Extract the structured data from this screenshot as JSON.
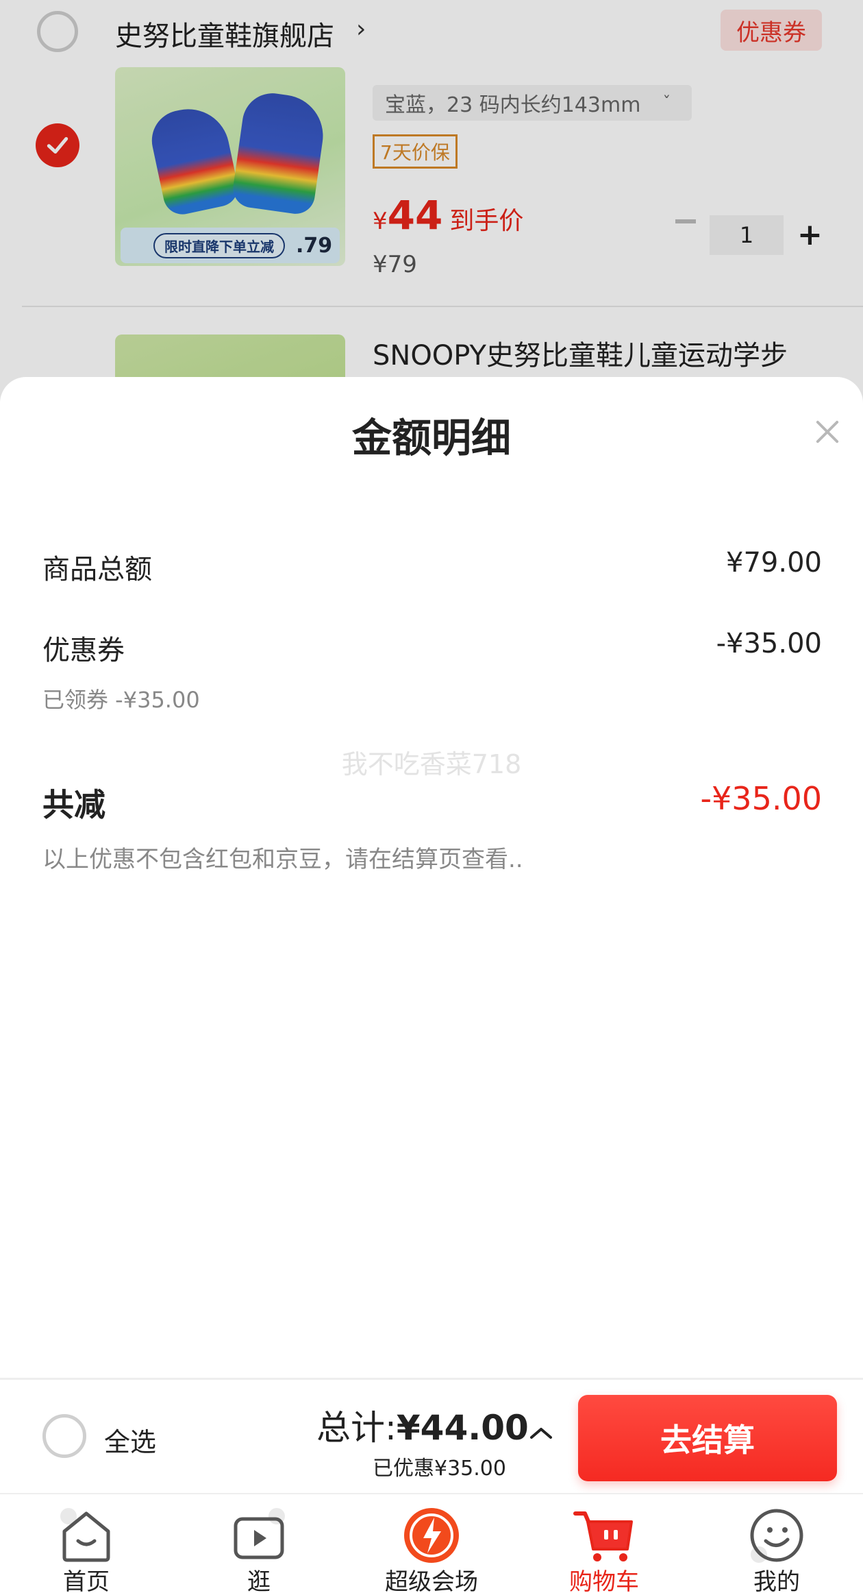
{
  "store": {
    "name": "史努比童鞋旗舰店",
    "chevron": "›",
    "coupon_tag": "优惠券"
  },
  "item": {
    "image_banner_text": "限时直降下单立减",
    "image_banner_price": ".79",
    "variant": "宝蓝，23 码内长约143mm",
    "variant_chevron": "ˇ",
    "guarantee": "7天价保",
    "price_currency": "¥",
    "price_value": "44",
    "price_label": "到手价",
    "original_price": "¥79",
    "quantity": "1",
    "plus": "+"
  },
  "item2": {
    "title": "SNOOPY史努比童鞋儿童运动学步"
  },
  "sheet": {
    "title": "金额明细",
    "rows": [
      {
        "label": "商品总额",
        "value": "¥79.00"
      },
      {
        "label": "优惠券",
        "value": "-¥35.00",
        "sub": "已领券 -¥35.00"
      }
    ],
    "watermark": "我不吃香菜718",
    "total_label": "共减",
    "total_value": "-¥35.00",
    "note": "以上优惠不包含红包和京豆，请在结算页查看.."
  },
  "checkout": {
    "select_all": "全选",
    "total_prefix": "总计:",
    "total_amount": "¥44.00",
    "saved": "已优惠¥35.00",
    "button": "去结算"
  },
  "nav": {
    "items": [
      {
        "label": "首页",
        "icon": "home-icon"
      },
      {
        "label": "逛",
        "icon": "video-icon"
      },
      {
        "label": "超级会场",
        "icon": "super-venue-icon"
      },
      {
        "label": "购物车",
        "icon": "cart-icon",
        "active": true
      },
      {
        "label": "我的",
        "icon": "profile-icon"
      }
    ]
  },
  "colors": {
    "accent": "#e8251a",
    "guarantee": "#d98a2b",
    "muted": "#888888"
  }
}
